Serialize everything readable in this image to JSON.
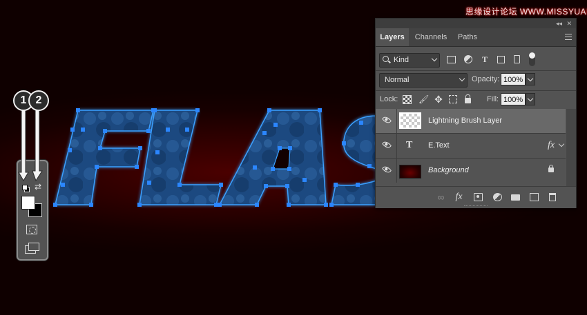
{
  "watermark": "思缘设计论坛 WWW.MISSYUAN.COM",
  "canvas": {
    "text_fragment": "FLAS",
    "fill_color": "#1d4a80",
    "anchor_color": "#2b86ff",
    "glow_color": "#3aa0ff"
  },
  "callouts": [
    {
      "label": "1"
    },
    {
      "label": "2"
    }
  ],
  "tools": {
    "foreground": "#ffffff",
    "background": "#000000",
    "swap_glyph": "⇄"
  },
  "panel": {
    "tabs": [
      {
        "label": "Layers",
        "active": true
      },
      {
        "label": "Channels",
        "active": false
      },
      {
        "label": "Paths",
        "active": false
      }
    ],
    "collapse_glyph": "◂◂",
    "close_glyph": "✕",
    "filter": {
      "kind": "Kind",
      "type_glyph": "T"
    },
    "blend_mode": "Normal",
    "opacity_label": "Opacity:",
    "opacity": "100%",
    "lock_label": "Lock:",
    "fill_label": "Fill:",
    "fill": "100%",
    "lock_move_glyph": "✥",
    "lock_artboard_glyph": "⊡",
    "lock_brush_glyph": "🖌",
    "layers": [
      {
        "name": "Lightning Brush Layer",
        "selected": true,
        "thumb": "transparent"
      },
      {
        "name": "E.Text",
        "selected": false,
        "thumb": "type",
        "type_glyph": "T",
        "fx": "fx"
      },
      {
        "name": "Background",
        "selected": false,
        "thumb": "image"
      }
    ],
    "bottom": {
      "link_glyph": "∞",
      "fx_glyph": "fx"
    }
  }
}
